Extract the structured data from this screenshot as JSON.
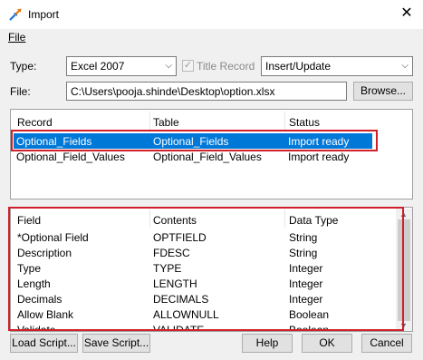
{
  "window": {
    "title": "Import",
    "close_glyph": "✕"
  },
  "menu": {
    "file": "File"
  },
  "form": {
    "type_label": "Type:",
    "type_value": "Excel 2007",
    "title_record_label": "Title Record",
    "title_record_checked": true,
    "mode_value": "Insert/Update",
    "file_label": "File:",
    "file_value": "C:\\Users\\pooja.shinde\\Desktop\\option.xlsx",
    "browse_label": "Browse..."
  },
  "records": {
    "headers": [
      "Record",
      "Table",
      "Status"
    ],
    "rows": [
      {
        "record": "Optional_Fields",
        "table": "Optional_Fields",
        "status": "Import ready",
        "selected": true
      },
      {
        "record": "Optional_Field_Values",
        "table": "Optional_Field_Values",
        "status": "Import ready",
        "selected": false
      }
    ]
  },
  "fields": {
    "headers": [
      "Field",
      "Contents",
      "Data Type"
    ],
    "rows": [
      {
        "field": "*Optional Field",
        "contents": "OPTFIELD",
        "type": "String"
      },
      {
        "field": "Description",
        "contents": "FDESC",
        "type": "String"
      },
      {
        "field": "Type",
        "contents": "TYPE",
        "type": "Integer"
      },
      {
        "field": "Length",
        "contents": "LENGTH",
        "type": "Integer"
      },
      {
        "field": "Decimals",
        "contents": "DECIMALS",
        "type": "Integer"
      },
      {
        "field": "Allow Blank",
        "contents": "ALLOWNULL",
        "type": "Boolean"
      },
      {
        "field": "Validate",
        "contents": "VALIDATE",
        "type": "Boolean"
      }
    ]
  },
  "buttons": {
    "load_script": "Load Script...",
    "save_script": "Save Script...",
    "help": "Help",
    "ok": "OK",
    "cancel": "Cancel"
  },
  "colors": {
    "selection": "#0078d7",
    "highlight_box": "#d0202a"
  }
}
